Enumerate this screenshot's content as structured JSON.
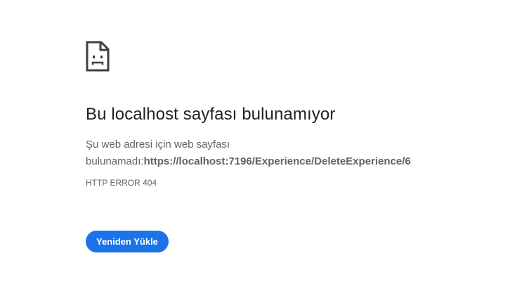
{
  "icon": {
    "name": "sad-page-icon",
    "color": "#3c4043"
  },
  "error": {
    "title": "Bu localhost sayfası bulunamıyor",
    "description_prefix": "Şu web adresi için web sayfası bulunamadı:",
    "url": "https://localhost:7196/Experience/DeleteExperience/6",
    "code": "HTTP ERROR 404"
  },
  "actions": {
    "reload_label": "Yeniden Yükle"
  },
  "colors": {
    "accent": "#1a73e8",
    "title": "#202124",
    "text": "#5f6368"
  }
}
